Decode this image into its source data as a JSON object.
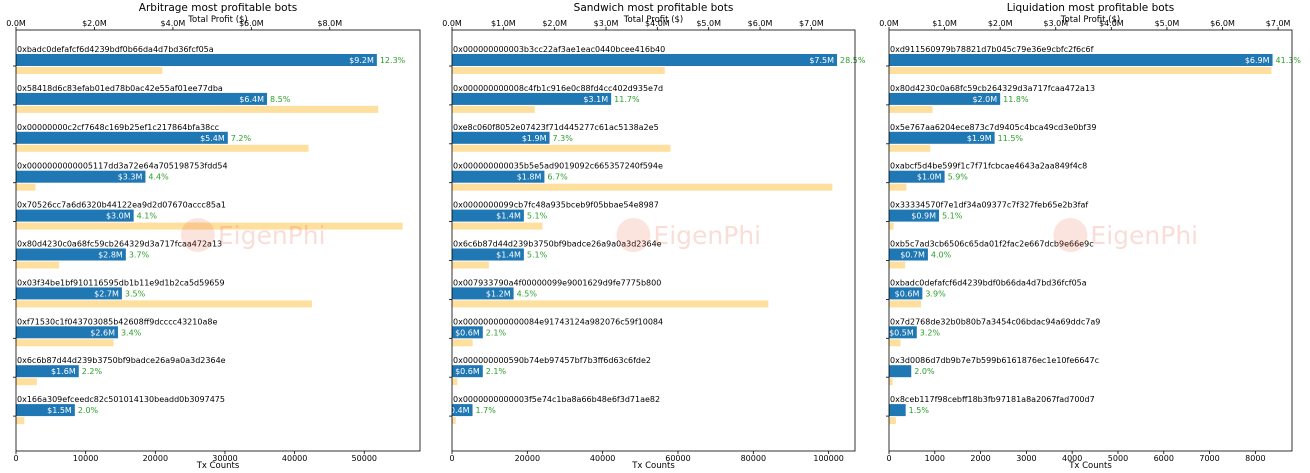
{
  "watermark": "EigenPhi",
  "style": {
    "profit_bar_color": "#1f77b4",
    "count_bar_color": "#ffdf9e",
    "percent_text_color": "#2ca02c",
    "watermark_color": "#e8684a"
  },
  "chart_data": [
    {
      "type": "bar",
      "title": "Arbitrage most profitable bots",
      "top_axis_label": "Total Profit ($)",
      "bottom_axis_label": "Tx Counts",
      "profit_ticks": [
        "0.0M",
        "$2.0M",
        "$4.0M",
        "$6.0M",
        "$8.0M"
      ],
      "profit_xlim": [
        0,
        10.3
      ],
      "count_ticks": [
        "0",
        "10000",
        "20000",
        "30000",
        "40000",
        "50000"
      ],
      "count_xlim": [
        0,
        58000
      ],
      "bots": [
        {
          "address": "0xbadc0defafcf6d4239bdf0b66da4d7bd36fcf05a",
          "profit": 9.2,
          "profit_label": "$9.2M",
          "percent": "12.3%",
          "tx_count": 21000
        },
        {
          "address": "0x58418d6c83efab01ed78b0ac42e55af01ee77dba",
          "profit": 6.4,
          "profit_label": "$6.4M",
          "percent": "8.5%",
          "tx_count": 52000
        },
        {
          "address": "0x00000000c2cf7648c169b25ef1c217864bfa38cc",
          "profit": 5.4,
          "profit_label": "$5.4M",
          "percent": "7.2%",
          "tx_count": 42000
        },
        {
          "address": "0x0000000000005117dd3a72e64a705198753fdd54",
          "profit": 3.3,
          "profit_label": "$3.3M",
          "percent": "4.4%",
          "tx_count": 2800
        },
        {
          "address": "0x70526cc7a6d6320b44122ea9d2d07670accc85a1",
          "profit": 3.0,
          "profit_label": "$3.0M",
          "percent": "4.1%",
          "tx_count": 55500
        },
        {
          "address": "0x80d4230c0a68fc59cb264329d3a717fcaa472a13",
          "profit": 2.8,
          "profit_label": "$2.8M",
          "percent": "3.7%",
          "tx_count": 6200
        },
        {
          "address": "0x03f34be1bf910116595db1b11e9d1b2ca5d59659",
          "profit": 2.7,
          "profit_label": "$2.7M",
          "percent": "3.5%",
          "tx_count": 42500
        },
        {
          "address": "0xf71530c1f043703085b42608ff9dcccc43210a8e",
          "profit": 2.6,
          "profit_label": "$2.6M",
          "percent": "3.4%",
          "tx_count": 14000
        },
        {
          "address": "0x6c6b87d44d239b3750bf9badce26a9a0a3d2364e",
          "profit": 1.6,
          "profit_label": "$1.6M",
          "percent": "2.2%",
          "tx_count": 3000
        },
        {
          "address": "0x166a309efceedc82c501014130beadd0b3097475",
          "profit": 1.5,
          "profit_label": "$1.5M",
          "percent": "2.0%",
          "tx_count": 1200
        }
      ]
    },
    {
      "type": "bar",
      "title": "Sandwich most profitable bots",
      "top_axis_label": "Total Profit ($)",
      "bottom_axis_label": "Tx Counts",
      "profit_ticks": [
        "0.0M",
        "$1.0M",
        "$2.0M",
        "$3.0M",
        "$4.0M",
        "$5.0M",
        "$6.0M",
        "$7.0M"
      ],
      "profit_xlim": [
        0,
        7.85
      ],
      "count_ticks": [
        "0",
        "20000",
        "40000",
        "60000",
        "80000",
        "100000"
      ],
      "count_xlim": [
        0,
        107000
      ],
      "bots": [
        {
          "address": "0x000000000003b3cc22af3ae1eac0440bcee416b40",
          "profit": 7.5,
          "profit_label": "$7.5M",
          "percent": "28.5%",
          "tx_count": 56500
        },
        {
          "address": "0x000000000008c4fb1c916e0c88fd4cc402d935e7d",
          "profit": 3.1,
          "profit_label": "$3.1M",
          "percent": "11.7%",
          "tx_count": 22000
        },
        {
          "address": "0xe8c060f8052e07423f71d445277c61ac5138a2e5",
          "profit": 1.9,
          "profit_label": "$1.9M",
          "percent": "7.3%",
          "tx_count": 58000
        },
        {
          "address": "0x000000000035b5e5ad9019092c665357240f594e",
          "profit": 1.8,
          "profit_label": "$1.8M",
          "percent": "6.7%",
          "tx_count": 101000
        },
        {
          "address": "0x0000000099cb7fc48a935bceb9f05bbae54e8987",
          "profit": 1.4,
          "profit_label": "$1.4M",
          "percent": "5.1%",
          "tx_count": 24000
        },
        {
          "address": "0x6c6b87d44d239b3750bf9badce26a9a0a3d2364e",
          "profit": 1.4,
          "profit_label": "$1.4M",
          "percent": "5.1%",
          "tx_count": 9800
        },
        {
          "address": "0x007933790a4f00000099e9001629d9fe7775b800",
          "profit": 1.2,
          "profit_label": "$1.2M",
          "percent": "4.5%",
          "tx_count": 84000
        },
        {
          "address": "0x000000000000084e91743124a982076c59f10084",
          "profit": 0.6,
          "profit_label": "$0.6M",
          "percent": "2.1%",
          "tx_count": 5500
        },
        {
          "address": "0x000000000590b74eb97457bf7b3ff6d63c6fde2",
          "profit": 0.6,
          "profit_label": "$0.6M",
          "percent": "2.1%",
          "tx_count": 1400
        },
        {
          "address": "0x0000000000003f5e74c1ba8a66b48e6f3d71ae82",
          "profit": 0.4,
          "profit_label": "$0.4M",
          "percent": "1.7%",
          "tx_count": 1000
        }
      ]
    },
    {
      "type": "bar",
      "title": "Liquidation most profitable bots",
      "top_axis_label": "Total Profit ($)",
      "bottom_axis_label": "Tx Counts",
      "profit_ticks": [
        "0.0M",
        "$1.0M",
        "$2.0M",
        "$3.0M",
        "$4.0M",
        "$5.0M",
        "$6.0M",
        "$7.0M"
      ],
      "profit_xlim": [
        0,
        7.25
      ],
      "count_ticks": [
        "0",
        "1000",
        "2000",
        "3000",
        "4000",
        "5000",
        "6000",
        "7000",
        "8000"
      ],
      "count_xlim": [
        0,
        8800
      ],
      "bots": [
        {
          "address": "0xd911560979b78821d7b045c79e36e9cbfc2f6c6f",
          "profit": 6.9,
          "profit_label": "$6.9M",
          "percent": "41.3%",
          "tx_count": 8350
        },
        {
          "address": "0x80d4230c0a68fc59cb264329d3a717fcaa472a13",
          "profit": 2.0,
          "profit_label": "$2.0M",
          "percent": "11.8%",
          "tx_count": 950
        },
        {
          "address": "0x5e767aa6204ece873c7d9405c4bca49cd3e0bf39",
          "profit": 1.9,
          "profit_label": "$1.9M",
          "percent": "11.5%",
          "tx_count": 900
        },
        {
          "address": "0xabcf5d4be599f1c7f71fcbcae4643a2aa849f4c8",
          "profit": 1.0,
          "profit_label": "$1.0M",
          "percent": "5.9%",
          "tx_count": 380
        },
        {
          "address": "0x33334570f7e1df34a09377c7f327feb65e2b3faf",
          "profit": 0.9,
          "profit_label": "$0.9M",
          "percent": "5.1%",
          "tx_count": 100
        },
        {
          "address": "0xb5c7ad3cb6506c65da01f2fac2e667dcb9e66e9c",
          "profit": 0.7,
          "profit_label": "$0.7M",
          "percent": "4.0%",
          "tx_count": 350
        },
        {
          "address": "0xbadc0defafcf6d4239bdf0b66da4d7bd36fcf05a",
          "profit": 0.6,
          "profit_label": "$0.6M",
          "percent": "3.9%",
          "tx_count": 700
        },
        {
          "address": "0x7d2768de32b0b80b7a3454c06bdac94a69ddc7a9",
          "profit": 0.5,
          "profit_label": "$0.5M",
          "percent": "3.2%",
          "tx_count": 250
        },
        {
          "address": "0x3d0086d7db9b7e7b599b6161876ec1e10fe6647c",
          "profit": 0.4,
          "profit_label": "",
          "percent": "2.0%",
          "tx_count": 80
        },
        {
          "address": "0x8ceb117f98cebff18b3fb97181a8a2067fad700d7",
          "profit": 0.3,
          "profit_label": "",
          "percent": "1.5%",
          "tx_count": 150
        }
      ]
    }
  ]
}
